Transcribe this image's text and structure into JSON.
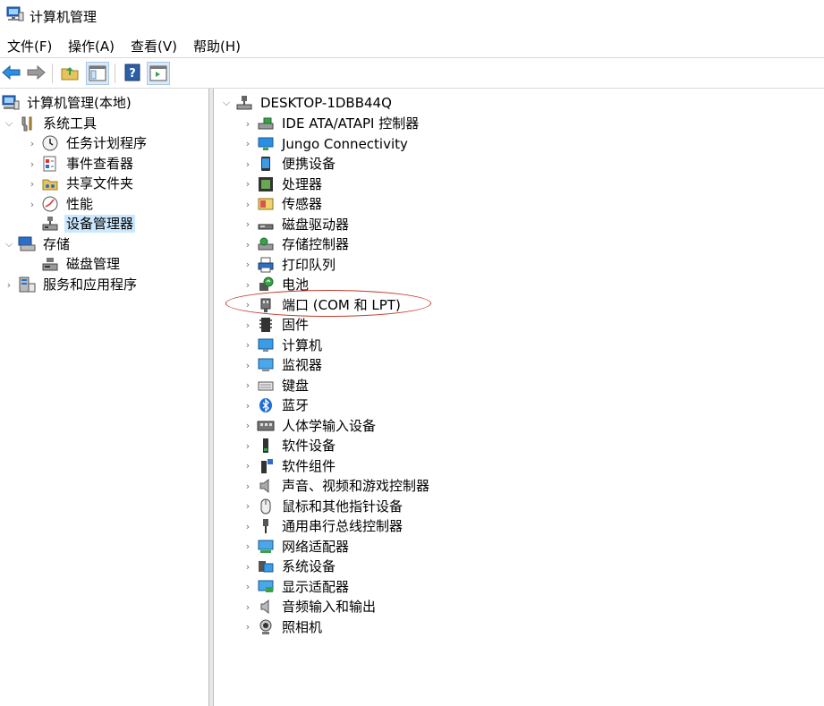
{
  "window": {
    "title": "计算机管理",
    "icon": "computer-management-icon"
  },
  "menu": {
    "file": "文件(F)",
    "action": "操作(A)",
    "view": "查看(V)",
    "help": "帮助(H)"
  },
  "toolbar": {
    "back": "back-arrow-icon",
    "forward": "forward-arrow-icon",
    "up": "folder-up-icon",
    "show_hide": "show-hide-tree-icon",
    "help": "help-icon",
    "action_pane": "action-pane-icon"
  },
  "tree": {
    "root": "计算机管理(本地)",
    "system_tools": "系统工具",
    "task_scheduler": "任务计划程序",
    "event_viewer": "事件查看器",
    "shared_folders": "共享文件夹",
    "performance": "性能",
    "device_manager": "设备管理器",
    "storage": "存储",
    "disk_management": "磁盘管理",
    "services_apps": "服务和应用程序"
  },
  "devices": {
    "computer": "DESKTOP-1DBB44Q",
    "items": [
      {
        "label": "IDE ATA/ATAPI 控制器",
        "icon": "ide-controller-icon"
      },
      {
        "label": "Jungo Connectivity",
        "icon": "network-monitor-icon"
      },
      {
        "label": "便携设备",
        "icon": "portable-device-icon"
      },
      {
        "label": "处理器",
        "icon": "processor-icon"
      },
      {
        "label": "传感器",
        "icon": "sensor-icon"
      },
      {
        "label": "磁盘驱动器",
        "icon": "disk-drive-icon"
      },
      {
        "label": "存储控制器",
        "icon": "storage-controller-icon"
      },
      {
        "label": "打印队列",
        "icon": "printer-icon"
      },
      {
        "label": "电池",
        "icon": "battery-icon"
      },
      {
        "label": "端口 (COM 和 LPT)",
        "icon": "port-icon"
      },
      {
        "label": "固件",
        "icon": "firmware-icon"
      },
      {
        "label": "计算机",
        "icon": "computer-icon"
      },
      {
        "label": "监视器",
        "icon": "monitor-icon"
      },
      {
        "label": "键盘",
        "icon": "keyboard-icon"
      },
      {
        "label": "蓝牙",
        "icon": "bluetooth-icon"
      },
      {
        "label": "人体学输入设备",
        "icon": "hid-icon"
      },
      {
        "label": "软件设备",
        "icon": "software-device-icon"
      },
      {
        "label": "软件组件",
        "icon": "software-component-icon"
      },
      {
        "label": "声音、视频和游戏控制器",
        "icon": "speaker-icon"
      },
      {
        "label": "鼠标和其他指针设备",
        "icon": "mouse-icon"
      },
      {
        "label": "通用串行总线控制器",
        "icon": "usb-icon"
      },
      {
        "label": "网络适配器",
        "icon": "network-adapter-icon"
      },
      {
        "label": "系统设备",
        "icon": "system-device-icon"
      },
      {
        "label": "显示适配器",
        "icon": "display-adapter-icon"
      },
      {
        "label": "音频输入和输出",
        "icon": "audio-io-icon"
      },
      {
        "label": "照相机",
        "icon": "camera-icon"
      }
    ]
  },
  "colors": {
    "selection": "#cce8ff",
    "highlight_oval": "#c0392b"
  }
}
